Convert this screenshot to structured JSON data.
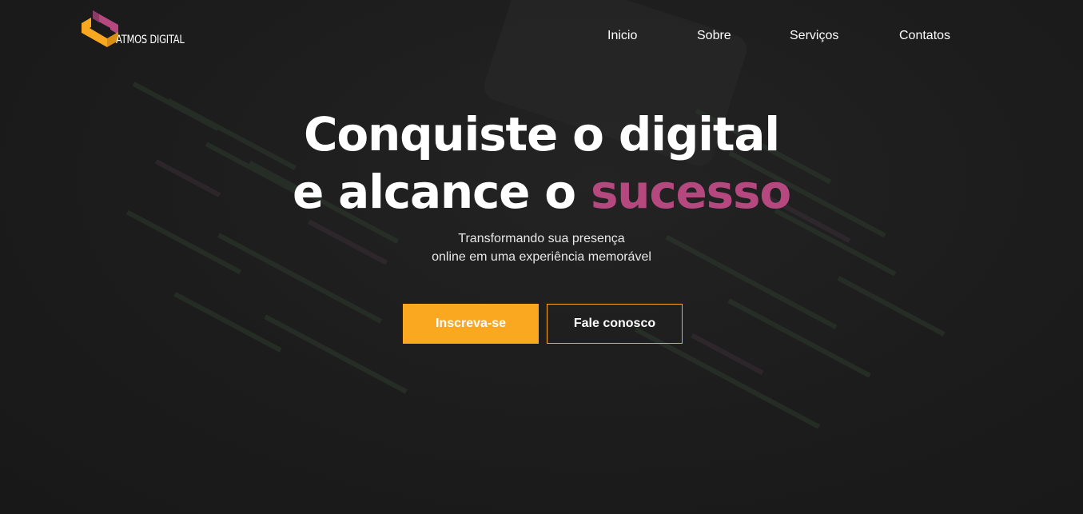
{
  "brand": {
    "name": "ATMOS DIGITAL",
    "colors": {
      "orange": "#f9a820",
      "magenta": "#b5487f",
      "background": "#1b1b1b"
    },
    "logo_icon": "atmos-logo-icon"
  },
  "nav": {
    "items": [
      {
        "label": "Inicio"
      },
      {
        "label": "Sobre"
      },
      {
        "label": "Serviços"
      },
      {
        "label": "Contatos"
      }
    ]
  },
  "hero": {
    "headline_line1": "Conquiste o digital",
    "headline_line2_prefix": "e alcance o ",
    "headline_line2_accent": "sucesso",
    "subtitle_line1": "Transformando sua presença",
    "subtitle_line2": "online em uma experiência memorável",
    "primary_button": "Inscreva-se",
    "secondary_button": "Fale conosco"
  }
}
